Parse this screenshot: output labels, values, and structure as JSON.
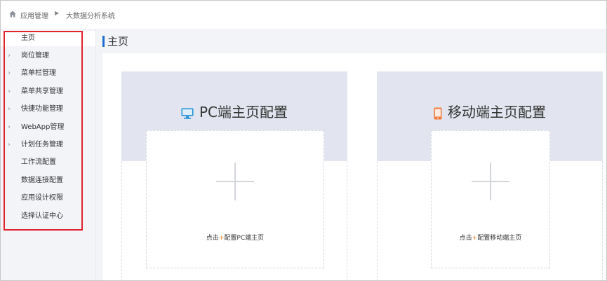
{
  "breadcrumb": {
    "home": "应用管理",
    "separator": "▶",
    "current": "大数据分析系统"
  },
  "sidebar": {
    "items": [
      {
        "label": "主页",
        "expandable": false,
        "active": true
      },
      {
        "label": "岗位管理",
        "expandable": true
      },
      {
        "label": "菜单栏管理",
        "expandable": true
      },
      {
        "label": "菜单共享管理",
        "expandable": true
      },
      {
        "label": "快捷功能管理",
        "expandable": true
      },
      {
        "label": "WebApp管理",
        "expandable": true
      },
      {
        "label": "计划任务管理",
        "expandable": true
      },
      {
        "label": "工作流配置",
        "expandable": false
      },
      {
        "label": "数据连接配置",
        "expandable": false
      },
      {
        "label": "应用设计权限",
        "expandable": false
      },
      {
        "label": "选择认证中心",
        "expandable": false
      }
    ],
    "chevron": "›"
  },
  "main": {
    "title": "主页",
    "cards": [
      {
        "title": "PC端主页配置",
        "icon": "monitor-icon",
        "icon_color": "#1e8fd8",
        "add_prefix": "点击",
        "add_plus": "+",
        "add_suffix": "配置PC端主页"
      },
      {
        "title": "移动端主页配置",
        "icon": "mobile-icon",
        "icon_color": "#f07b3a",
        "add_prefix": "点击",
        "add_plus": "+",
        "add_suffix": "配置移动端主页"
      }
    ]
  },
  "colors": {
    "accent": "#1e6fd1",
    "highlight_border": "#e0232b",
    "plus_orange": "#f0801e"
  }
}
